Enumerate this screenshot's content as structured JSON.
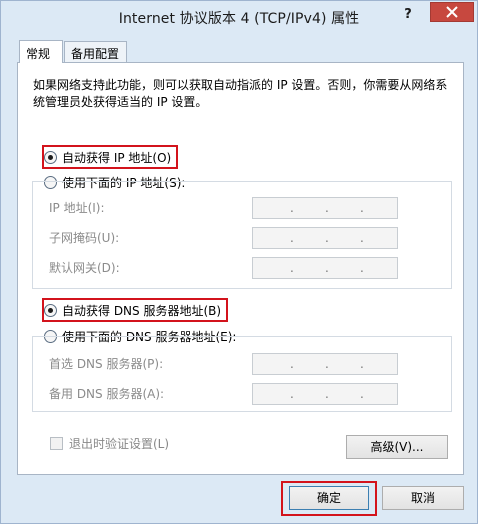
{
  "window": {
    "title": "Internet 协议版本 4 (TCP/IPv4) 属性",
    "help_label": "?"
  },
  "tabs": [
    {
      "label": "常规",
      "active": true
    },
    {
      "label": "备用配置",
      "active": false
    }
  ],
  "description": "如果网络支持此功能，则可以获取自动指派的 IP 设置。否则，你需要从网络系统管理员处获得适当的 IP 设置。",
  "ip": {
    "auto_label": "自动获得 IP 地址(O)",
    "auto_checked": true,
    "manual_label": "使用下面的 IP 地址(S):",
    "manual_checked": false,
    "fields": [
      {
        "label": "IP 地址(I):",
        "value": ". . ."
      },
      {
        "label": "子网掩码(U):",
        "value": ". . ."
      },
      {
        "label": "默认网关(D):",
        "value": ". . ."
      }
    ]
  },
  "dns": {
    "auto_label": "自动获得 DNS 服务器地址(B)",
    "auto_checked": true,
    "manual_label": "使用下面的 DNS 服务器地址(E):",
    "manual_checked": false,
    "fields": [
      {
        "label": "首选 DNS 服务器(P):",
        "value": ". . ."
      },
      {
        "label": "备用 DNS 服务器(A):",
        "value": ". . ."
      }
    ]
  },
  "validate_label": "退出时验证设置(L)",
  "validate_checked": false,
  "advanced_label": "高级(V)...",
  "ok_label": "确定",
  "cancel_label": "取消",
  "colors": {
    "highlight": "#d3131c",
    "close_button": "#c7483f",
    "window_background": "#dce9f5"
  },
  "icons": {
    "close": "close-icon"
  }
}
